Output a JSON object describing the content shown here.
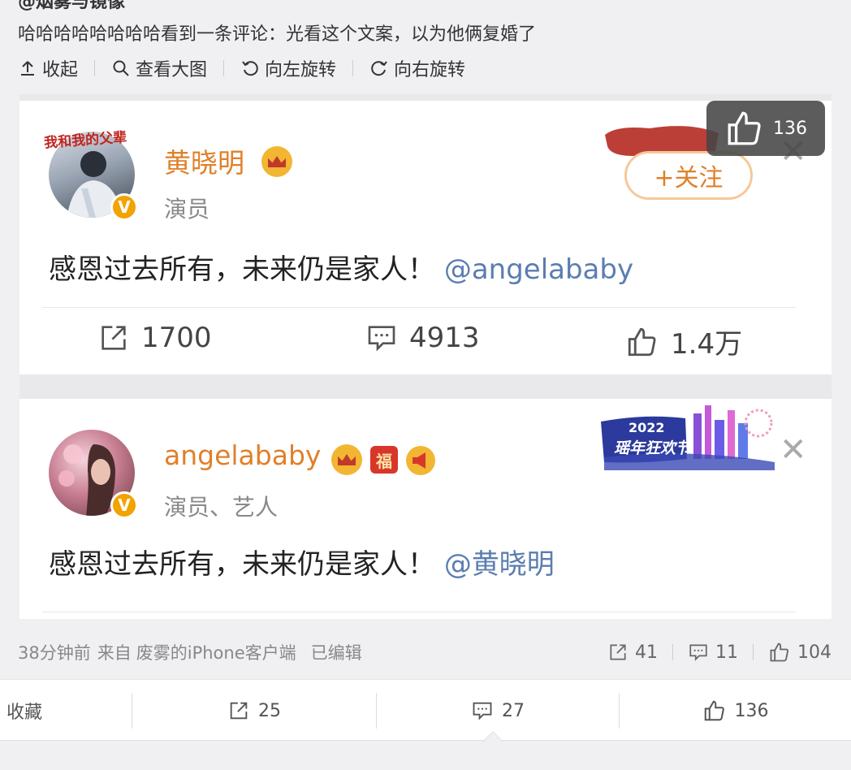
{
  "post": {
    "author": "@烟雾与镜像",
    "text": "哈哈哈哈哈哈哈哈看到一条评论：光看这个文案，以为他俩复婚了"
  },
  "toolbar": {
    "collapse": "收起",
    "view_large": "查看大图",
    "rotate_left": "向左旋转",
    "rotate_right": "向右旋转"
  },
  "image": {
    "like_bubble_count": "136",
    "card1": {
      "avatar_text": "我和我的父辈",
      "name": "黄晓明",
      "title": "演员",
      "follow": "+关注",
      "body": "感恩过去所有，未来仍是家人！",
      "mention": "@angelababy",
      "reposts": "1700",
      "comments": "4913",
      "likes": "1.4万"
    },
    "card2": {
      "name": "angelababy",
      "fu_badge": "福",
      "title": "演员、艺人",
      "body": "感恩过去所有，未来仍是家人！",
      "mention": "@黄晓明",
      "banner_year": "2022",
      "banner_text": "瑶年狂欢节"
    }
  },
  "meta": {
    "time": "38分钟前",
    "source_prefix": "来自",
    "source": "废雾的iPhone客户端",
    "edited": "已编辑",
    "reposts": "41",
    "comments": "11",
    "likes": "104"
  },
  "actionbar": {
    "favorite": "收藏",
    "reposts": "25",
    "comments": "27",
    "likes": "136"
  },
  "colors": {
    "accent_orange": "#e0802a",
    "mention_blue": "#5b7db0",
    "background": "#f0f0f3"
  }
}
